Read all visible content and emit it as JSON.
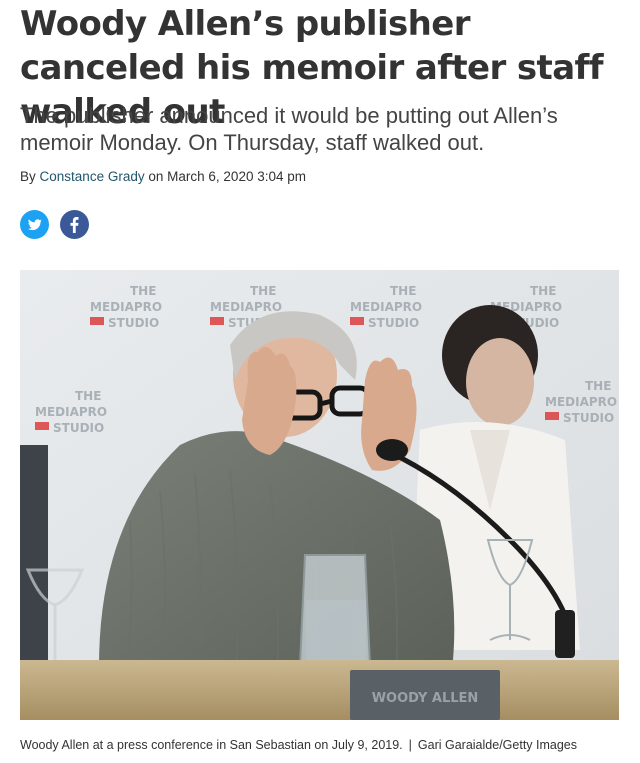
{
  "article": {
    "headline": "Woody Allen’s publisher canceled his memoir after staff walked out",
    "dek": "The publisher announced it would be putting out Allen’s memoir Monday. On Thursday, staff walked out.",
    "byline": {
      "prefix": "By",
      "author": "Constance Grady",
      "date_prefix": "on",
      "date": "March 6, 2020 3:04 pm"
    }
  },
  "share": {
    "items": [
      {
        "name": "twitter",
        "icon": "twitter-bird-icon",
        "color": "#1da1f2"
      },
      {
        "name": "facebook",
        "icon": "facebook-f-icon",
        "color": "#3b5998"
      }
    ]
  },
  "photo": {
    "backdrop_text": {
      "line1": "THE",
      "line2": "MEDIAPRO",
      "line3": "STUDIO"
    },
    "nameplate_text": "WOODY ALLEN",
    "caption": "Woody Allen at a press conference in San Sebastian on July 9, 2019.",
    "separator": "|",
    "credit": "Gari Garaialde/Getty Images"
  }
}
